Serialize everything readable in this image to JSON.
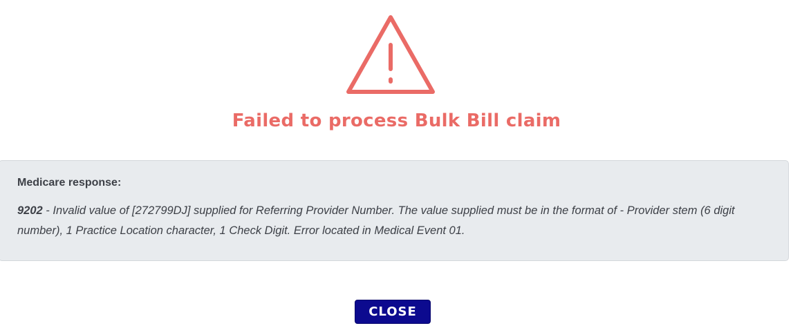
{
  "dialog": {
    "icon": "warning-triangle-icon",
    "title": "Failed to process Bulk Bill claim",
    "colors": {
      "error": "#ea6b66",
      "panel_background": "#e8ebee",
      "button_background": "#0c0a8f"
    }
  },
  "response": {
    "label": "Medicare response:",
    "code": "9202",
    "message": " - Invalid value of [272799DJ] supplied for Referring Provider Number. The value supplied must be in the format of - Provider stem (6 digit number), 1 Practice Location character, 1 Check Digit. Error located in Medical Event 01."
  },
  "actions": {
    "close_label": "CLOSE"
  }
}
